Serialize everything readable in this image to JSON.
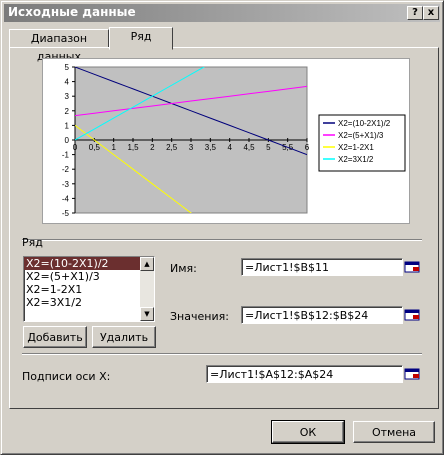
{
  "window": {
    "title": "Исходные данные",
    "help_label": "?",
    "close_label": "x"
  },
  "tabs": [
    {
      "label": "Диапазон данных",
      "active": false
    },
    {
      "label": "Ряд",
      "active": true
    }
  ],
  "chart_data": {
    "type": "line",
    "x": [
      0,
      0.5,
      1,
      1.5,
      2,
      2.5,
      3,
      3.5,
      4,
      4.5,
      5,
      5.5,
      6
    ],
    "x_ticks": [
      "0",
      "0,5",
      "1",
      "1,5",
      "2",
      "2,5",
      "3",
      "3,5",
      "4",
      "4,5",
      "5",
      "5,5",
      "6"
    ],
    "y_ticks": [
      "5",
      "4",
      "3",
      "2",
      "1",
      "0",
      "-1",
      "-2",
      "-3",
      "-4",
      "-5"
    ],
    "xlim": [
      0,
      6
    ],
    "ylim": [
      -5,
      5
    ],
    "grid": false,
    "plot_area_color": "#c0c0c0",
    "legend_position": "right",
    "series": [
      {
        "name": "X2=(10-2X1)/2",
        "color": "#00007b",
        "values": [
          5,
          4.5,
          4,
          3.5,
          3,
          2.5,
          2,
          1.5,
          1,
          0.5,
          0,
          -0.5,
          -1
        ]
      },
      {
        "name": "X2=(5+X1)/3",
        "color": "#ff00ff",
        "values": [
          1.67,
          1.83,
          2,
          2.17,
          2.33,
          2.5,
          2.67,
          2.83,
          3,
          3.17,
          3.33,
          3.5,
          3.67
        ]
      },
      {
        "name": "X2=1-2X1",
        "color": "#ffff00",
        "values": [
          1,
          0,
          -1,
          -2,
          -3,
          -4,
          -5,
          -6,
          -7,
          -8,
          -9,
          -10,
          -11
        ]
      },
      {
        "name": "X2=3X1/2",
        "color": "#00ffff",
        "values": [
          0,
          0.75,
          1.5,
          2.25,
          3,
          3.75,
          4.5,
          5.25,
          6,
          6.75,
          7.5,
          8.25,
          9
        ]
      }
    ]
  },
  "series_section": {
    "label": "Ряд",
    "items": [
      "X2=(10-2X1)/2",
      "X2=(5+X1)/3",
      "X2=1-2X1",
      "X2=3X1/2"
    ],
    "selected_index": 0,
    "add_button": "Добавить",
    "delete_button": "Удалить"
  },
  "fields": {
    "name_label": "Имя:",
    "name_value": "=Лист1!$B$11",
    "values_label": "Значения:",
    "values_value": "=Лист1!$B$12:$B$24",
    "xlabels_label": "Подписи оси X:",
    "xlabels_value": "=Лист1!$A$12:$A$24"
  },
  "buttons": {
    "ok": "ОК",
    "cancel": "Отмена"
  },
  "colors": {
    "selection": "#6b2f2f",
    "ref_icon_red": "#c00000",
    "ref_icon_blue": "#000080"
  }
}
